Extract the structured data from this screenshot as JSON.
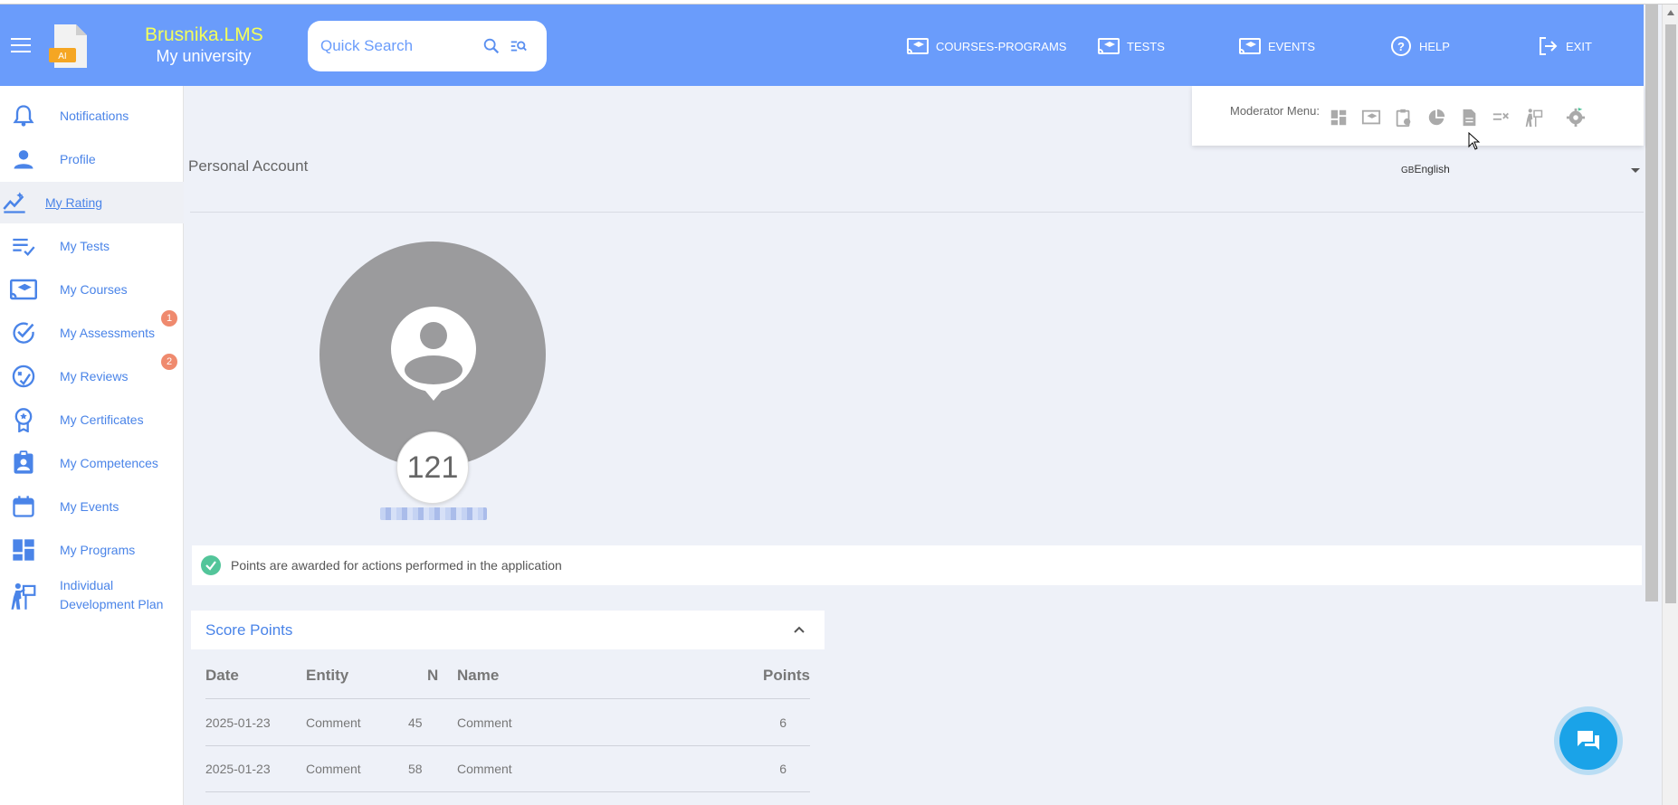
{
  "header": {
    "brand_top": "Brusnika.LMS",
    "brand_bottom": "My university",
    "logo_text": "AI",
    "search_placeholder": "Quick Search",
    "nav": [
      {
        "label": "COURSES-PROGRAMS",
        "icon": "courses-icon"
      },
      {
        "label": "TESTS",
        "icon": "tests-icon"
      },
      {
        "label": "EVENTS",
        "icon": "events-icon"
      },
      {
        "label": "HELP",
        "icon": "help-icon"
      },
      {
        "label": "EXIT",
        "icon": "exit-icon"
      }
    ]
  },
  "sidebar": {
    "items": [
      {
        "label": "Notifications",
        "icon": "bell-icon"
      },
      {
        "label": "Profile",
        "icon": "person-icon"
      },
      {
        "label": "My Rating",
        "icon": "rating-chart-icon",
        "active": true
      },
      {
        "label": "My Tests",
        "icon": "checklist-icon"
      },
      {
        "label": "My Courses",
        "icon": "courses-icon"
      },
      {
        "label": "My Assessments",
        "icon": "check-circle-icon",
        "badge": "1"
      },
      {
        "label": "My Reviews",
        "icon": "review-icon",
        "badge": "2"
      },
      {
        "label": "My Certificates",
        "icon": "award-icon"
      },
      {
        "label": "My Competences",
        "icon": "badge-person-icon"
      },
      {
        "label": "My Events",
        "icon": "calendar-icon"
      },
      {
        "label": "My Programs",
        "icon": "dashboard-icon"
      },
      {
        "label": "Individual Development Plan",
        "label_line1": "Individual",
        "label_line2": "Development Plan",
        "icon": "development-plan-icon"
      }
    ]
  },
  "main": {
    "page_title": "Personal Account",
    "moderator_label": "Moderator Menu:",
    "language": {
      "flag": "GB",
      "value": "English"
    },
    "score": "121",
    "info_text": "Points are awarded for actions performed in the application",
    "panel_title": "Score Points",
    "table": {
      "columns": [
        "Date",
        "Entity",
        "N",
        "Name",
        "Points"
      ],
      "rows": [
        [
          "2025-01-23",
          "Comment",
          "45",
          "Comment",
          "6"
        ],
        [
          "2025-01-23",
          "Comment",
          "58",
          "Comment",
          "6"
        ]
      ]
    }
  },
  "colors": {
    "header": "#6a9cfb",
    "brand_yellow": "#f4ff5a",
    "link_blue": "#4a84e8",
    "badge": "#ef8a6e",
    "success": "#53c59a",
    "chat": "#1aa3e8"
  }
}
